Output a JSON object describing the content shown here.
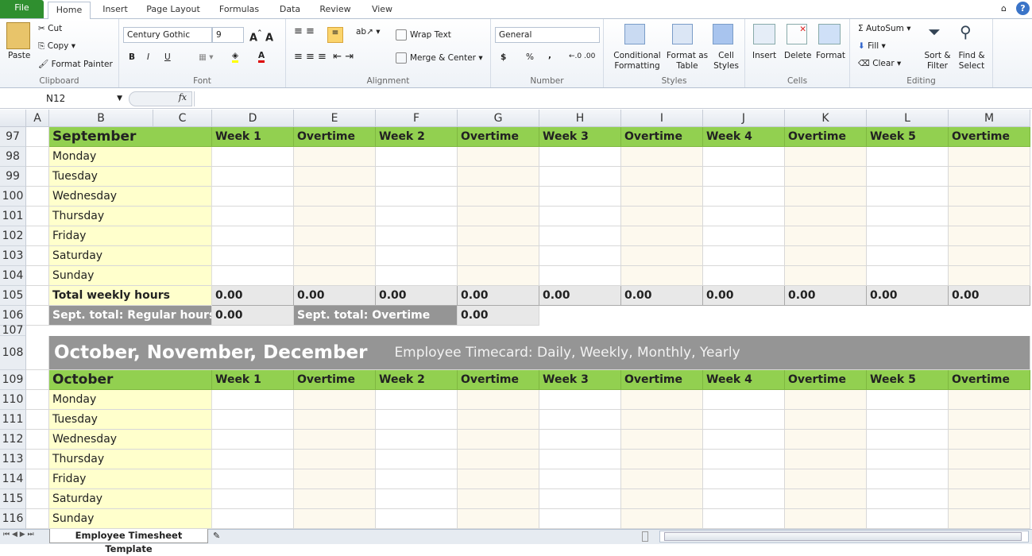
{
  "ribbon_tabs": [
    "File",
    "Home",
    "Insert",
    "Page Layout",
    "Formulas",
    "Data",
    "Review",
    "View"
  ],
  "clipboard": {
    "paste": "Paste",
    "cut": "Cut",
    "copy": "Copy",
    "format_painter": "Format Painter",
    "label": "Clipboard"
  },
  "font": {
    "name": "Century Gothic",
    "size": "9",
    "label": "Font",
    "bold": "B",
    "italic": "I",
    "underline": "U"
  },
  "alignment": {
    "wrap": "Wrap Text",
    "merge": "Merge & Center",
    "label": "Alignment"
  },
  "number": {
    "format": "General",
    "currency": "$",
    "percent": "%",
    "comma": ",",
    "label": "Number"
  },
  "styles": {
    "conditional": "Conditional Formatting",
    "table": "Format as Table",
    "cell": "Cell Styles",
    "label": "Styles"
  },
  "cells": {
    "insert": "Insert",
    "delete": "Delete",
    "format": "Format",
    "label": "Cells"
  },
  "editing": {
    "autosum": "AutoSum",
    "fill": "Fill",
    "clear": "Clear",
    "sort": "Sort & Filter",
    "find": "Find & Select",
    "label": "Editing"
  },
  "formula_bar": {
    "name_box": "N12",
    "fx": "fx",
    "value": ""
  },
  "columns": [
    "A",
    "B",
    "C",
    "D",
    "E",
    "F",
    "G",
    "H",
    "I",
    "J",
    "K",
    "L",
    "M"
  ],
  "week_headers": [
    "Week 1",
    "Overtime",
    "Week 2",
    "Overtime",
    "Week 3",
    "Overtime",
    "Week 4",
    "Overtime",
    "Week 5",
    "Overtime"
  ],
  "days": [
    "Monday",
    "Tuesday",
    "Wednesday",
    "Thursday",
    "Friday",
    "Saturday",
    "Sunday"
  ],
  "september": {
    "title": "September",
    "total_label": "Total weekly hours",
    "totals": [
      "0.00",
      "0.00",
      "0.00",
      "0.00",
      "0.00",
      "0.00",
      "0.00",
      "0.00",
      "0.00",
      "0.00"
    ],
    "regular_label": "Sept. total: Regular hours",
    "regular_value": "0.00",
    "overtime_label": "Sept. total: Overtime",
    "overtime_value": "0.00"
  },
  "quarter_banner": {
    "title": "October, November, December",
    "subtitle": "Employee Timecard: Daily, Weekly, Monthly, Yearly"
  },
  "october": {
    "title": "October"
  },
  "row_numbers": {
    "sept_header": "97",
    "sept_days": [
      "98",
      "99",
      "100",
      "101",
      "102",
      "103",
      "104"
    ],
    "total": "105",
    "month_total": "106",
    "spacer": "107",
    "banner": "108",
    "oct_header": "109",
    "oct_days": [
      "110",
      "111",
      "112",
      "113",
      "114",
      "115",
      "116"
    ]
  },
  "sheet_tabs": [
    "Employee Timesheet Template"
  ],
  "colors": {
    "green": "#92d050",
    "yellow": "#ffffcc",
    "cream": "#fdf9ee",
    "gray_dark": "#959595",
    "gray_light": "#e8e8e8",
    "file_tab": "#2f8f2f"
  }
}
